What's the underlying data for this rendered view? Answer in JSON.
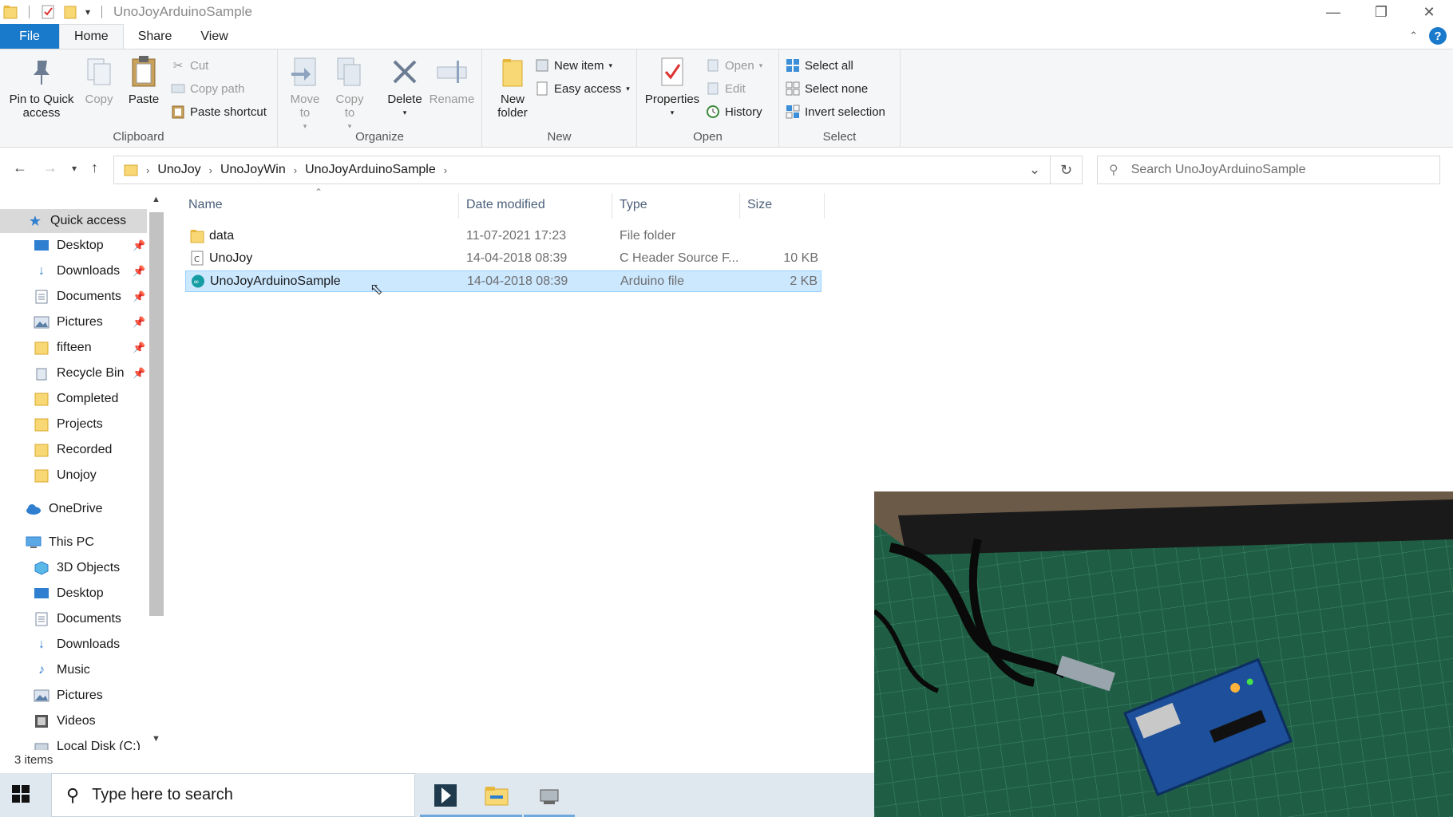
{
  "window": {
    "title": "UnoJoyArduinoSample"
  },
  "ribbon_tabs": [
    "File",
    "Home",
    "Share",
    "View"
  ],
  "clipboard": {
    "label": "Clipboard",
    "pin": "Pin to Quick access",
    "copy": "Copy",
    "paste": "Paste",
    "cut": "Cut",
    "copy_path": "Copy path",
    "paste_shortcut": "Paste shortcut"
  },
  "organize": {
    "label": "Organize",
    "move_to": "Move to",
    "copy_to": "Copy to",
    "delete": "Delete",
    "rename": "Rename"
  },
  "new": {
    "label": "New",
    "new_folder": "New folder",
    "new_item": "New item",
    "easy_access": "Easy access"
  },
  "open": {
    "label": "Open",
    "properties": "Properties",
    "open": "Open",
    "edit": "Edit",
    "history": "History"
  },
  "select": {
    "label": "Select",
    "select_all": "Select all",
    "select_none": "Select none",
    "invert_selection": "Invert selection"
  },
  "address": {
    "crumbs": [
      "UnoJoy",
      "UnoJoyWin",
      "UnoJoyArduinoSample"
    ]
  },
  "search": {
    "placeholder": "Search UnoJoyArduinoSample"
  },
  "nav": {
    "quick_access": "Quick access",
    "quick_items": [
      "Desktop",
      "Downloads",
      "Documents",
      "Pictures",
      "fifteen",
      "Recycle Bin",
      "Completed",
      "Projects",
      "Recorded",
      "Unojoy"
    ],
    "onedrive": "OneDrive",
    "this_pc": "This PC",
    "pc_items": [
      "3D Objects",
      "Desktop",
      "Documents",
      "Downloads",
      "Music",
      "Pictures",
      "Videos",
      "Local Disk (C:)"
    ]
  },
  "columns": {
    "name": "Name",
    "date": "Date modified",
    "type": "Type",
    "size": "Size"
  },
  "files": [
    {
      "name": "data",
      "date": "11-07-2021 17:23",
      "type": "File folder",
      "size": "",
      "icon": "folder-icon"
    },
    {
      "name": "UnoJoy",
      "date": "14-04-2018 08:39",
      "type": "C Header Source F...",
      "size": "10 KB",
      "icon": "c-header-file-icon"
    },
    {
      "name": "UnoJoyArduinoSample",
      "date": "14-04-2018 08:39",
      "type": "Arduino file",
      "size": "2 KB",
      "icon": "arduino-file-icon"
    }
  ],
  "status": {
    "items": "3 items"
  },
  "taskbar": {
    "search_placeholder": "Type here to search"
  },
  "colors": {
    "accent": "#1979ca",
    "selection": "#cce8ff",
    "folder": "#f8d775"
  }
}
